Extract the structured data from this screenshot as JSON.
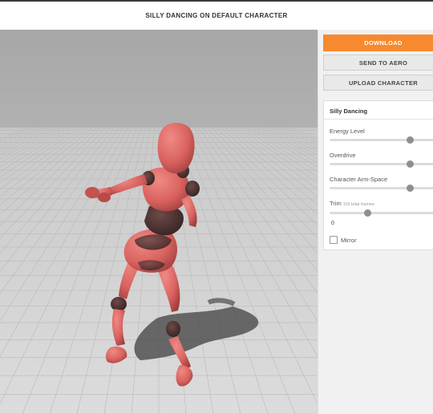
{
  "header": {
    "title": "SILLY DANCING ON DEFAULT CHARACTER"
  },
  "actions": {
    "download": "DOWNLOAD",
    "send": "SEND TO AERO",
    "upload": "UPLOAD CHARACTER"
  },
  "panel": {
    "title": "Silly Dancing",
    "sliders": [
      {
        "label": "Energy Level",
        "level_percent": 70
      },
      {
        "label": "Overdrive",
        "level_percent": 70
      },
      {
        "label": "Character Arm-Space",
        "level_percent": 70
      }
    ],
    "trim": {
      "label": "Trim",
      "sublabel": "116 total frames",
      "value": "0",
      "level_percent": 33
    },
    "mirror": {
      "label": "Mirror",
      "checked": false
    }
  },
  "colors": {
    "accent": "#f7892e",
    "character": "#d9625f",
    "floor": "#d2d2d2",
    "sky": "#a9a9a9"
  }
}
